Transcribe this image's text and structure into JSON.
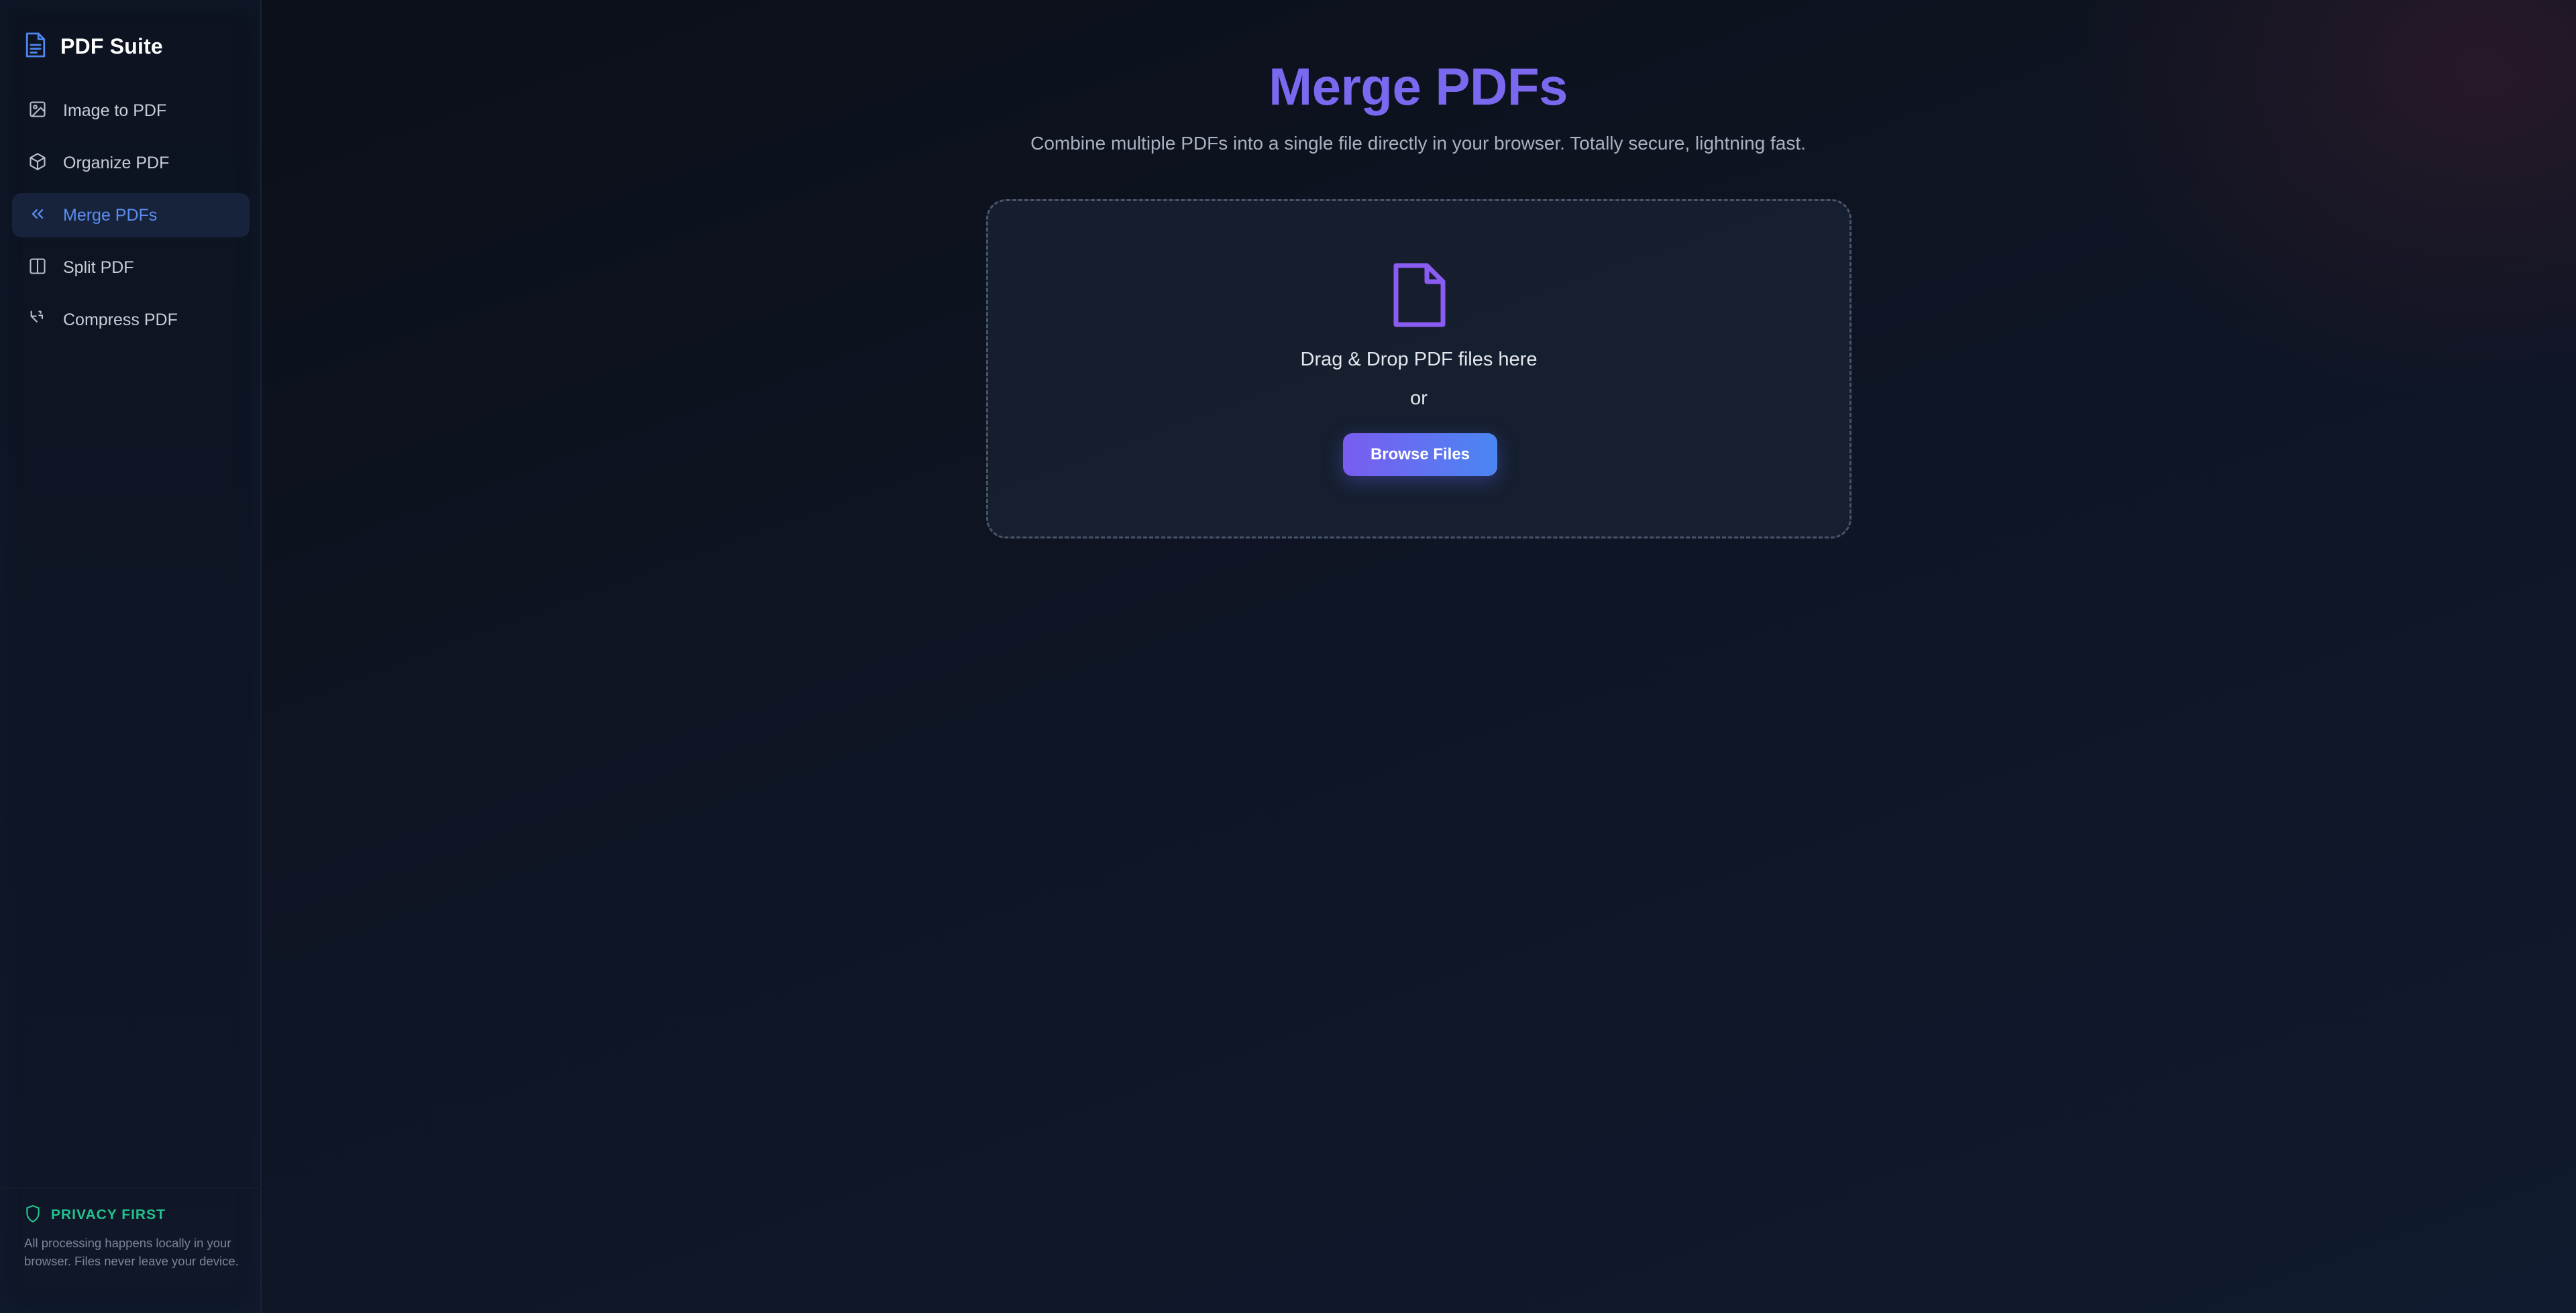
{
  "sidebar": {
    "brand": {
      "title": "PDF Suite",
      "icon": "file-text-icon"
    },
    "items": [
      {
        "label": "Image to PDF",
        "icon": "image-icon",
        "active": false
      },
      {
        "label": "Organize PDF",
        "icon": "box-icon",
        "active": false
      },
      {
        "label": "Merge PDFs",
        "icon": "chevrons-left-icon",
        "active": true
      },
      {
        "label": "Split PDF",
        "icon": "columns-icon",
        "active": false
      },
      {
        "label": "Compress PDF",
        "icon": "compress-icon",
        "active": false
      }
    ],
    "privacy": {
      "title": "PRIVACY FIRST",
      "text": "All processing happens locally in your browser. Files never leave your device.",
      "icon": "shield-icon"
    }
  },
  "main": {
    "title": "Merge PDFs",
    "subtitle": "Combine multiple PDFs into a single file directly in your browser. Totally secure, lightning fast.",
    "dropzone": {
      "icon": "file-icon",
      "text": "Drag & Drop PDF files here",
      "or": "or",
      "button_label": "Browse Files"
    }
  },
  "colors": {
    "accent_purple": "#7a68ee",
    "accent_blue": "#5b8df0",
    "privacy_green": "#22c38e",
    "background": "#0f1524"
  }
}
